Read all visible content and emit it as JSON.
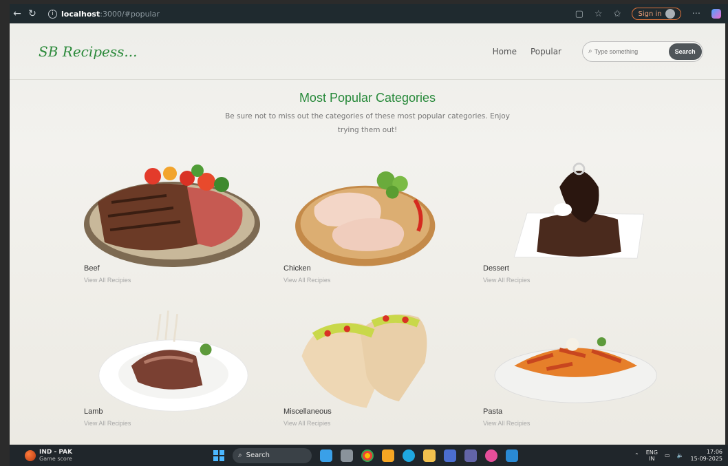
{
  "browser": {
    "host": "localhost",
    "path": ":3000/#popular",
    "signin_label": "Sign in"
  },
  "site": {
    "logo": "SB Recipess...",
    "nav": {
      "home": "Home",
      "popular": "Popular"
    },
    "search": {
      "placeholder": "Type something",
      "button": "Search"
    }
  },
  "hero": {
    "title": "Most Popular Categories",
    "subtitle": "Be sure not to miss out the categories of these most popular categories. Enjoy trying them out!"
  },
  "categories": [
    {
      "name": "Beef",
      "link": "View All Recipies"
    },
    {
      "name": "Chicken",
      "link": "View All Recipies"
    },
    {
      "name": "Dessert",
      "link": "View All Recipies"
    },
    {
      "name": "Lamb",
      "link": "View All Recipies"
    },
    {
      "name": "Miscellaneous",
      "link": "View All Recipies"
    },
    {
      "name": "Pasta",
      "link": "View All Recipies"
    }
  ],
  "taskbar": {
    "news_title": "IND - PAK",
    "news_sub": "Game score",
    "search_label": "Search",
    "lang": "ENG",
    "lang_sub": "IN",
    "time": "17:06",
    "date": "15-09-2025"
  }
}
